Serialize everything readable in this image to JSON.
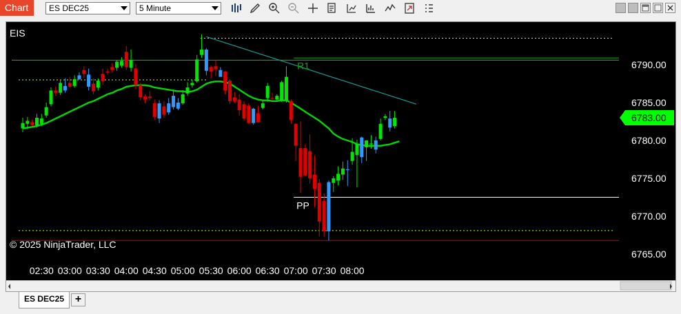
{
  "toolbar": {
    "chart_label": "Chart",
    "instrument": "ES DEC25",
    "interval": "5 Minute",
    "icons": [
      "bar-type-icon",
      "drawing-tool-icon",
      "zoom-in-icon",
      "zoom-out-icon",
      "crosshair-icon",
      "data-box-icon",
      "indicators-icon",
      "strategies-icon",
      "chart-trader-icon",
      "properties-icon",
      "more-icon"
    ],
    "window_buttons": [
      "minimize",
      "maximize",
      "restore",
      "close"
    ]
  },
  "chart_data": {
    "type": "candlestick",
    "symbol_label": "EIS",
    "copyright": "© 2025 NinjaTrader, LLC",
    "y_ticks": [
      "6790.00",
      "6785.00",
      "6780.00",
      "6775.00",
      "6770.00",
      "6765.00"
    ],
    "y_tick_values": [
      6790,
      6785,
      6780,
      6775,
      6770,
      6765
    ],
    "x_ticks": [
      "02:30",
      "03:00",
      "03:30",
      "04:00",
      "04:30",
      "05:00",
      "05:30",
      "06:00",
      "06:30",
      "07:00",
      "07:30",
      "08:00"
    ],
    "ylim": [
      6763.8,
      6795.4
    ],
    "time_start": "02:10",
    "bar_minutes": 5,
    "last_price": "6783.00",
    "last_price_value": 6783.0,
    "colors": {
      "up": "#00e600",
      "down": "#e00000",
      "up_alt": "#3399ff",
      "ma": "#00d800",
      "trend": "#1a9a9a",
      "r1": "#00b000",
      "pp": "#ffffff",
      "low_line": "#d00000",
      "dash": "#c8ff00"
    },
    "candles": [
      {
        "o": 6781.6,
        "h": 6783.0,
        "l": 6781.1,
        "c": 6782.3,
        "col": "up"
      },
      {
        "o": 6782.2,
        "h": 6783.1,
        "l": 6781.5,
        "c": 6782.6,
        "col": "up"
      },
      {
        "o": 6782.1,
        "h": 6782.8,
        "l": 6781.9,
        "c": 6782.4,
        "col": "down"
      },
      {
        "o": 6782.0,
        "h": 6783.5,
        "l": 6781.7,
        "c": 6783.0,
        "col": "up"
      },
      {
        "o": 6782.2,
        "h": 6783.5,
        "l": 6781.9,
        "c": 6782.9,
        "col": "up"
      },
      {
        "o": 6783.3,
        "h": 6785.0,
        "l": 6783.0,
        "c": 6784.4,
        "col": "up"
      },
      {
        "o": 6784.8,
        "h": 6787.0,
        "l": 6784.5,
        "c": 6786.6,
        "col": "up"
      },
      {
        "o": 6786.6,
        "h": 6787.1,
        "l": 6785.9,
        "c": 6786.3,
        "col": "down"
      },
      {
        "o": 6786.3,
        "h": 6788.0,
        "l": 6786.0,
        "c": 6787.6,
        "col": "up"
      },
      {
        "o": 6787.2,
        "h": 6788.2,
        "l": 6786.3,
        "c": 6786.6,
        "col": "up_alt"
      },
      {
        "o": 6787.1,
        "h": 6788.4,
        "l": 6786.9,
        "c": 6787.6,
        "col": "down"
      },
      {
        "o": 6787.2,
        "h": 6788.6,
        "l": 6787.0,
        "c": 6788.1,
        "col": "up"
      },
      {
        "o": 6788.1,
        "h": 6789.0,
        "l": 6788.0,
        "c": 6788.6,
        "col": "up_alt"
      },
      {
        "o": 6788.8,
        "h": 6789.8,
        "l": 6788.2,
        "c": 6789.3,
        "col": "down"
      },
      {
        "o": 6788.7,
        "h": 6789.5,
        "l": 6786.6,
        "c": 6787.1,
        "col": "up_alt"
      },
      {
        "o": 6787.5,
        "h": 6788.2,
        "l": 6786.1,
        "c": 6786.5,
        "col": "down"
      },
      {
        "o": 6787.0,
        "h": 6788.2,
        "l": 6786.6,
        "c": 6787.9,
        "col": "up"
      },
      {
        "o": 6787.8,
        "h": 6789.5,
        "l": 6787.3,
        "c": 6788.8,
        "col": "down"
      },
      {
        "o": 6789.0,
        "h": 6789.5,
        "l": 6788.7,
        "c": 6789.1,
        "col": "down"
      },
      {
        "o": 6789.3,
        "h": 6790.2,
        "l": 6789.0,
        "c": 6789.7,
        "col": "down"
      },
      {
        "o": 6789.6,
        "h": 6790.6,
        "l": 6789.2,
        "c": 6790.4,
        "col": "up"
      },
      {
        "o": 6790.5,
        "h": 6791.0,
        "l": 6789.6,
        "c": 6789.9,
        "col": "up"
      },
      {
        "o": 6789.7,
        "h": 6792.5,
        "l": 6789.3,
        "c": 6791.7,
        "col": "down"
      },
      {
        "o": 6790.6,
        "h": 6792.0,
        "l": 6789.1,
        "c": 6789.6,
        "col": "up"
      },
      {
        "o": 6789.5,
        "h": 6790.1,
        "l": 6786.8,
        "c": 6787.3,
        "col": "down"
      },
      {
        "o": 6787.3,
        "h": 6787.6,
        "l": 6785.3,
        "c": 6785.7,
        "col": "down"
      },
      {
        "o": 6785.8,
        "h": 6786.1,
        "l": 6784.9,
        "c": 6785.4,
        "col": "down"
      },
      {
        "o": 6785.8,
        "h": 6786.5,
        "l": 6785.3,
        "c": 6785.6,
        "col": "down"
      },
      {
        "o": 6784.9,
        "h": 6785.4,
        "l": 6782.7,
        "c": 6783.1,
        "col": "down"
      },
      {
        "o": 6782.9,
        "h": 6785.3,
        "l": 6782.3,
        "c": 6784.9,
        "col": "up_alt"
      },
      {
        "o": 6784.5,
        "h": 6785.2,
        "l": 6783.0,
        "c": 6783.4,
        "col": "down"
      },
      {
        "o": 6783.7,
        "h": 6785.6,
        "l": 6783.4,
        "c": 6784.9,
        "col": "up_alt"
      },
      {
        "o": 6784.4,
        "h": 6786.7,
        "l": 6784.1,
        "c": 6785.9,
        "col": "up_alt"
      },
      {
        "o": 6785.0,
        "h": 6785.6,
        "l": 6784.0,
        "c": 6784.2,
        "col": "up_alt"
      },
      {
        "o": 6784.9,
        "h": 6786.6,
        "l": 6784.7,
        "c": 6786.1,
        "col": "up"
      },
      {
        "o": 6786.2,
        "h": 6787.7,
        "l": 6785.9,
        "c": 6787.0,
        "col": "up"
      },
      {
        "o": 6787.3,
        "h": 6788.0,
        "l": 6787.0,
        "c": 6787.6,
        "col": "up"
      },
      {
        "o": 6787.8,
        "h": 6791.3,
        "l": 6787.6,
        "c": 6790.7,
        "col": "up"
      },
      {
        "o": 6791.3,
        "h": 6794.0,
        "l": 6790.9,
        "c": 6792.0,
        "col": "up"
      },
      {
        "o": 6792.0,
        "h": 6792.2,
        "l": 6788.6,
        "c": 6789.2,
        "col": "up_alt"
      },
      {
        "o": 6789.7,
        "h": 6789.9,
        "l": 6788.2,
        "c": 6789.1,
        "col": "down"
      },
      {
        "o": 6789.8,
        "h": 6790.6,
        "l": 6788.5,
        "c": 6789.4,
        "col": "down"
      },
      {
        "o": 6789.3,
        "h": 6789.7,
        "l": 6788.4,
        "c": 6788.4,
        "col": "up_alt"
      },
      {
        "o": 6789.1,
        "h": 6789.2,
        "l": 6786.1,
        "c": 6786.6,
        "col": "down"
      },
      {
        "o": 6787.9,
        "h": 6788.1,
        "l": 6784.8,
        "c": 6785.2,
        "col": "down"
      },
      {
        "o": 6785.7,
        "h": 6786.4,
        "l": 6785.0,
        "c": 6785.2,
        "col": "down"
      },
      {
        "o": 6785.4,
        "h": 6786.1,
        "l": 6783.3,
        "c": 6784.0,
        "col": "down"
      },
      {
        "o": 6784.8,
        "h": 6785.2,
        "l": 6782.6,
        "c": 6782.9,
        "col": "down"
      },
      {
        "o": 6784.6,
        "h": 6784.9,
        "l": 6782.2,
        "c": 6782.3,
        "col": "down"
      },
      {
        "o": 6784.2,
        "h": 6784.3,
        "l": 6782.1,
        "c": 6782.3,
        "col": "up_alt"
      },
      {
        "o": 6783.6,
        "h": 6784.6,
        "l": 6782.4,
        "c": 6782.4,
        "col": "down"
      },
      {
        "o": 6784.3,
        "h": 6785.3,
        "l": 6784.1,
        "c": 6784.9,
        "col": "up"
      },
      {
        "o": 6785.6,
        "h": 6787.6,
        "l": 6785.1,
        "c": 6787.2,
        "col": "up"
      },
      {
        "o": 6785.6,
        "h": 6786.3,
        "l": 6785.3,
        "c": 6785.5,
        "col": "down"
      },
      {
        "o": 6785.4,
        "h": 6786.1,
        "l": 6785.2,
        "c": 6785.9,
        "col": "up"
      },
      {
        "o": 6785.3,
        "h": 6787.9,
        "l": 6785.1,
        "c": 6787.7,
        "col": "up"
      },
      {
        "o": 6788.4,
        "h": 6789.8,
        "l": 6785.0,
        "c": 6785.3,
        "col": "up"
      },
      {
        "o": 6785.2,
        "h": 6785.4,
        "l": 6782.2,
        "c": 6782.7,
        "col": "down"
      },
      {
        "o": 6782.2,
        "h": 6782.3,
        "l": 6777.3,
        "c": 6779.3,
        "col": "down"
      },
      {
        "o": 6779.0,
        "h": 6782.5,
        "l": 6773.1,
        "c": 6775.2,
        "col": "down"
      },
      {
        "o": 6775.4,
        "h": 6779.5,
        "l": 6775.3,
        "c": 6779.0,
        "col": "down"
      },
      {
        "o": 6778.6,
        "h": 6780.8,
        "l": 6774.3,
        "c": 6775.0,
        "col": "down"
      },
      {
        "o": 6775.5,
        "h": 6778.0,
        "l": 6771.2,
        "c": 6773.6,
        "col": "down"
      },
      {
        "o": 6774.4,
        "h": 6774.9,
        "l": 6767.3,
        "c": 6769.3,
        "col": "down"
      },
      {
        "o": 6772.0,
        "h": 6773.0,
        "l": 6767.3,
        "c": 6768.0,
        "col": "down"
      },
      {
        "o": 6768.0,
        "h": 6774.7,
        "l": 6766.8,
        "c": 6774.5,
        "col": "up_alt"
      },
      {
        "o": 6774.4,
        "h": 6775.3,
        "l": 6773.2,
        "c": 6775.0,
        "col": "up"
      },
      {
        "o": 6774.7,
        "h": 6776.6,
        "l": 6774.1,
        "c": 6775.6,
        "col": "up"
      },
      {
        "o": 6775.5,
        "h": 6777.2,
        "l": 6774.8,
        "c": 6776.3,
        "col": "up"
      },
      {
        "o": 6776.2,
        "h": 6777.4,
        "l": 6774.0,
        "c": 6776.2,
        "col": "up_alt"
      },
      {
        "o": 6777.3,
        "h": 6780.3,
        "l": 6776.8,
        "c": 6778.5,
        "col": "up"
      },
      {
        "o": 6778.1,
        "h": 6780.1,
        "l": 6773.8,
        "c": 6779.6,
        "col": "up"
      },
      {
        "o": 6780.4,
        "h": 6780.5,
        "l": 6777.0,
        "c": 6777.8,
        "col": "up_alt"
      },
      {
        "o": 6780.0,
        "h": 6780.0,
        "l": 6777.3,
        "c": 6779.1,
        "col": "up"
      },
      {
        "o": 6779.5,
        "h": 6780.7,
        "l": 6778.9,
        "c": 6779.6,
        "col": "up"
      },
      {
        "o": 6780.0,
        "h": 6780.5,
        "l": 6778.3,
        "c": 6778.8,
        "col": "up_alt"
      },
      {
        "o": 6780.2,
        "h": 6782.9,
        "l": 6780.0,
        "c": 6782.2,
        "col": "up"
      },
      {
        "o": 6783.0,
        "h": 6783.5,
        "l": 6782.7,
        "c": 6783.2,
        "col": "up"
      },
      {
        "o": 6782.9,
        "h": 6783.9,
        "l": 6781.2,
        "c": 6781.7,
        "col": "up_alt"
      },
      {
        "o": 6781.9,
        "h": 6783.9,
        "l": 6781.6,
        "c": 6783.0,
        "col": "up"
      }
    ],
    "ma": [
      6781.6,
      6781.7,
      6781.8,
      6781.9,
      6782.1,
      6782.3,
      6782.6,
      6782.9,
      6783.2,
      6783.5,
      6783.8,
      6784.1,
      6784.4,
      6784.7,
      6785.0,
      6785.2,
      6785.5,
      6785.8,
      6786.1,
      6786.3,
      6786.6,
      6786.8,
      6787.1,
      6787.2,
      6787.3,
      6787.3,
      6787.3,
      6787.2,
      6787.0,
      6786.9,
      6786.8,
      6786.7,
      6786.6,
      6786.5,
      6786.5,
      6786.4,
      6786.5,
      6786.7,
      6787.1,
      6787.5,
      6787.7,
      6787.8,
      6787.8,
      6787.7,
      6787.5,
      6787.1,
      6786.7,
      6786.3,
      6785.9,
      6785.6,
      6785.4,
      6785.3,
      6785.3,
      6785.2,
      6785.2,
      6785.3,
      6785.3,
      6785.0,
      6784.6,
      6784.2,
      6783.8,
      6783.4,
      6783.0,
      6782.6,
      6782.1,
      6781.6,
      6780.9,
      6780.5,
      6780.2,
      6780.0,
      6779.8,
      6779.5,
      6779.4,
      6779.3,
      6779.3,
      6779.3,
      6779.3,
      6779.4,
      6779.5,
      6779.7,
      6779.9
    ]
  },
  "overlays": {
    "r1_label": "R1",
    "pp_label": "PP",
    "r1_level": 6790.6,
    "pp_level": 6772.5,
    "support_level": 6766.8,
    "dashed_upper": 6793.5,
    "dashed_upper2": 6788.0,
    "dashed_lower": 6768.1,
    "trend_start": {
      "bar": 39,
      "price": 6793.7
    },
    "trend_end": {
      "bar": 83,
      "price": 6784.8
    },
    "r1_start_bar": 58,
    "pp_start_bar": 58
  },
  "bottom": {
    "tab_label": "ES DEC25",
    "add_tab": "+"
  }
}
